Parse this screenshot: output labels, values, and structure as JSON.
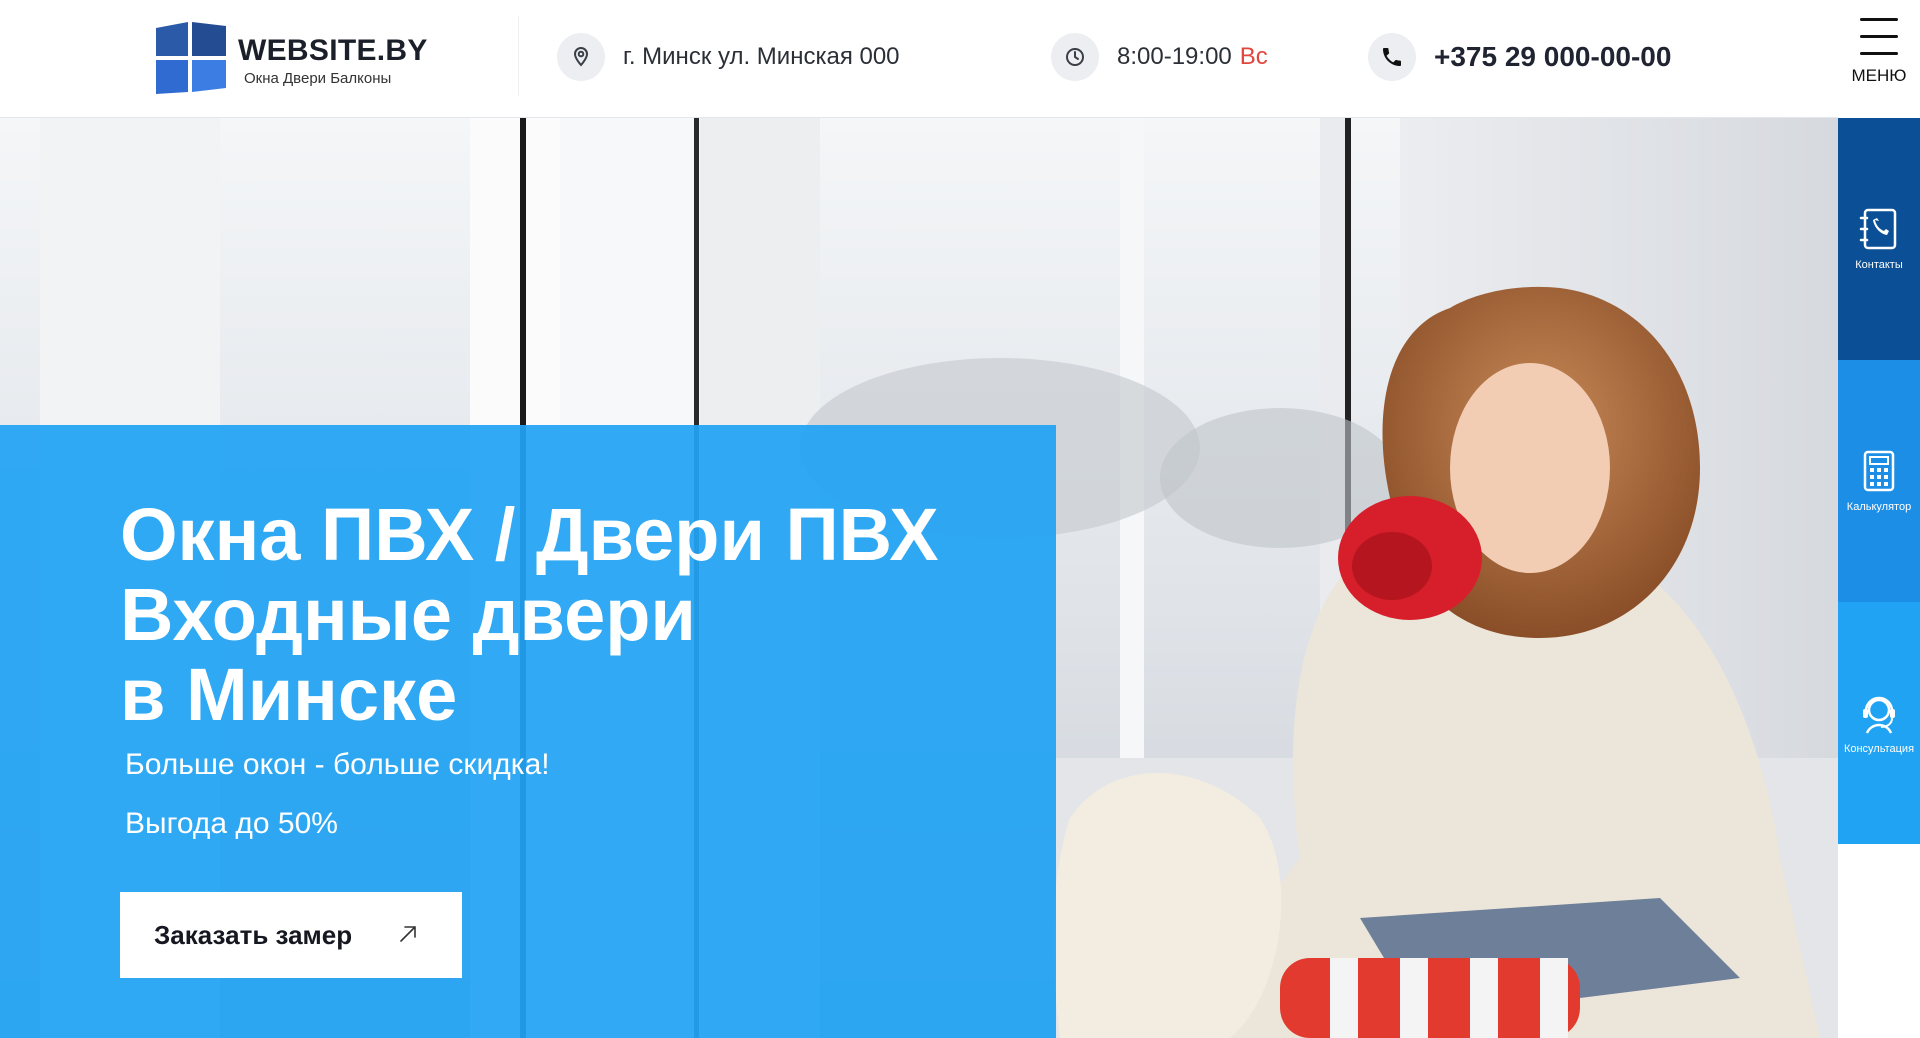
{
  "header": {
    "logo_name": "WEBSITE.BY",
    "logo_tagline": "Окна Двери Балконы",
    "address": "г. Минск ул. Минская 000",
    "hours": "8:00-19:00",
    "hours_day": "Вс",
    "phone": "+375 29 000-00-00",
    "icons": {
      "address": "location-pin-icon",
      "hours": "clock-icon",
      "phone": "phone-icon"
    }
  },
  "rail": {
    "menu_label": "МЕНЮ",
    "buttons": [
      {
        "label": "Контакты",
        "icon": "contacts-book-icon",
        "color": "#0b4f96"
      },
      {
        "label": "Калькулятор",
        "icon": "calculator-icon",
        "color": "#1d8ee6"
      },
      {
        "label": "Консультация",
        "icon": "headset-icon",
        "color": "#21a3f3"
      }
    ]
  },
  "hero": {
    "title_lines": [
      "Окна ПВХ / Двери ПВХ",
      "Входные двери",
      "в Минске"
    ],
    "subtitle_1": "Больше окон - больше скидка!",
    "subtitle_2": "Выгода до 50%",
    "cta_label": "Заказать замер",
    "panel_color": "#21a3f3"
  }
}
